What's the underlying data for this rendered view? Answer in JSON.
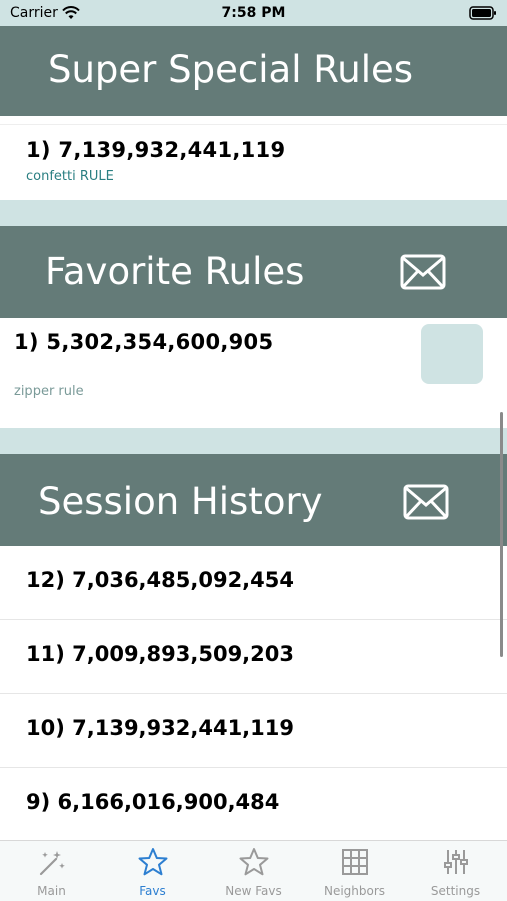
{
  "status_bar": {
    "carrier": "Carrier",
    "time": "7:58 PM"
  },
  "super_special": {
    "title": "Super Special Rules",
    "items": [
      {
        "line": "1)  7,139,932,441,119",
        "sub": "confetti RULE"
      }
    ]
  },
  "favorites": {
    "title": "Favorite Rules",
    "items": [
      {
        "line": "1)  5,302,354,600,905",
        "sub": "zipper rule"
      }
    ]
  },
  "session_history": {
    "title": "Session History",
    "rows": [
      "12)  7,036,485,092,454",
      "11)  7,009,893,509,203",
      "10)  7,139,932,441,119",
      "9)  6,166,016,900,484"
    ]
  },
  "tab_bar": {
    "tabs": [
      {
        "label": "Main",
        "icon": "magic-wand-icon"
      },
      {
        "label": "Favs",
        "icon": "star-filled-icon"
      },
      {
        "label": "New Favs",
        "icon": "star-outline-icon"
      },
      {
        "label": "Neighbors",
        "icon": "grid-icon"
      },
      {
        "label": "Settings",
        "icon": "sliders-icon"
      }
    ],
    "active_color": "#2d7fd1",
    "inactive_color": "#9a9a9a"
  },
  "colors": {
    "header": "#647b78",
    "accent_bg": "#cfe3e3",
    "teal_text": "#2a7f82"
  }
}
